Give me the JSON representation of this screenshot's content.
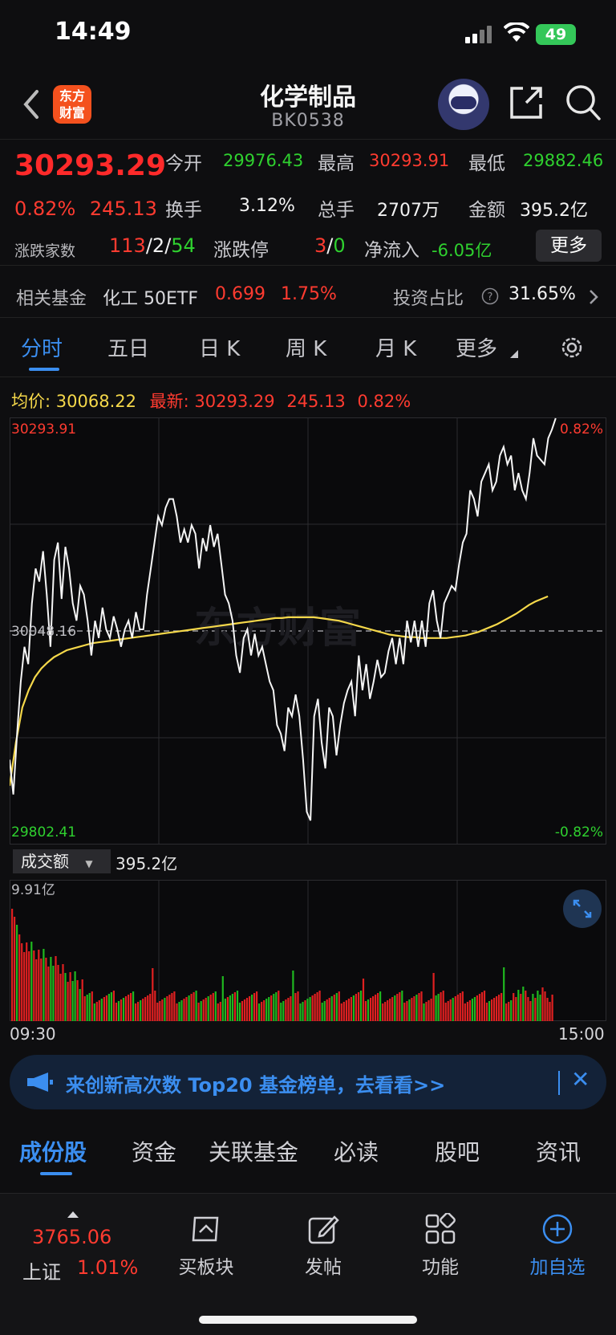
{
  "status_bar": {
    "time": "14:49",
    "battery": "49"
  },
  "header": {
    "title": "化学制品",
    "code": "BK0538",
    "logo_text": "东方财富"
  },
  "quote": {
    "last_price": "30293.29",
    "change_pct": "0.82%",
    "change_abs": "245.13",
    "open_label": "今开",
    "open_value": "29976.43",
    "high_label": "最高",
    "high_value": "30293.91",
    "low_label": "最低",
    "low_value": "29882.46",
    "turnover_rate_label": "换手",
    "turnover_rate_value": "3.12%",
    "volume_label": "总手",
    "volume_value": "2707万",
    "amount_label": "金额",
    "amount_value": "395.2亿",
    "breadth_label": "涨跌家数",
    "breadth_up": "113",
    "breadth_flat": "2",
    "breadth_down": "54",
    "breadth_sep": "/",
    "limit_label": "涨跌停",
    "limit_up": "3",
    "limit_down": "0",
    "netflow_label": "净流入",
    "netflow_value": "-6.05亿",
    "more_label": "更多"
  },
  "related_fund": {
    "label": "相关基金",
    "fund_name": "化工 50ETF",
    "fund_price": "0.699",
    "fund_pct": "1.75%",
    "ratio_label": "投资占比",
    "ratio_value": "31.65%"
  },
  "chart_tabs": [
    "分时",
    "五日",
    "日 K",
    "周 K",
    "月 K",
    "更多"
  ],
  "chart_header": {
    "avg_label": "均价:",
    "avg_value": "30068.22",
    "latest_label": "最新:",
    "latest_value": "30293.29",
    "latest_change": "245.13",
    "latest_pct": "0.82%"
  },
  "chart_data": {
    "type": "line",
    "y_top_label": "30293.91",
    "y_mid_label": "30048.16",
    "y_bottom_label": "29802.41",
    "pct_top_label": "0.82%",
    "pct_bottom_label": "-0.82%",
    "ylim": [
      29802.41,
      30293.91
    ],
    "prev_close": 30048.16,
    "x_start": "09:30",
    "x_end": "15:00",
    "series": [
      {
        "values": [
          29900,
          29860,
          29930,
          29990,
          30030,
          30010,
          30080,
          30120,
          30105,
          30140,
          30090,
          30030,
          30130,
          30150,
          30085,
          30145,
          30120,
          30080,
          30060,
          30100,
          30090,
          30060,
          30020,
          30060,
          30040,
          30075,
          30050,
          30040,
          30065,
          30050,
          30030,
          30050,
          30060,
          30040,
          30070,
          30050,
          30050,
          30090,
          30120,
          30150,
          30180,
          30170,
          30190,
          30200,
          30200,
          30180,
          30150,
          30165,
          30150,
          30170,
          30160,
          30120,
          30155,
          30140,
          30170,
          30145,
          30160,
          30125,
          30090,
          30080,
          30060,
          30020,
          30000,
          30040,
          30050,
          30020,
          30045,
          30020,
          30030,
          30010,
          29990,
          29980,
          29940,
          29930,
          29910,
          29960,
          29950,
          29975,
          29950,
          29900,
          29840,
          29830,
          29950,
          29970,
          29920,
          29890,
          29960,
          29950,
          29905,
          29940,
          29965,
          29980,
          29990,
          29950,
          30020,
          29980,
          30010,
          29970,
          29990,
          30015,
          29995,
          30000,
          30025,
          30040,
          30010,
          30040,
          30010,
          30060,
          30035,
          30060,
          30030,
          30060,
          30030,
          30080,
          30095,
          30060,
          30040,
          30080,
          30090,
          30100,
          30095,
          30125,
          30150,
          30160,
          30210,
          30200,
          30180,
          30220,
          30230,
          30240,
          30210,
          30220,
          30250,
          30260,
          30240,
          30250,
          30210,
          30230,
          30210,
          30200,
          30230,
          30270,
          30250,
          30245,
          30240,
          30270,
          30280,
          30293
        ]
      },
      {
        "name": "均价",
        "values": [
          29870,
          29920,
          29960,
          29980,
          29995,
          30005,
          30012,
          30018,
          30022,
          30026,
          30028,
          30030,
          30032,
          30034,
          30035,
          30036,
          30037,
          30038,
          30039,
          30040,
          30041,
          30042,
          30043,
          30044,
          30045,
          30046,
          30047,
          30048,
          30049,
          30050,
          30051,
          30052,
          30053,
          30054,
          30055,
          30056,
          30057,
          30058,
          30059,
          30060,
          30061,
          30062,
          30063,
          30063,
          30064,
          30064,
          30064,
          30064,
          30064,
          30063,
          30062,
          30061,
          30060,
          30058,
          30056,
          30054,
          30052,
          30050,
          30048,
          30046,
          30044,
          30043,
          30042,
          30041,
          30041,
          30040,
          30040,
          30040,
          30040,
          30040,
          30041,
          30042,
          30043,
          30045,
          30047,
          30050,
          30053,
          30056,
          30060,
          30064,
          30068,
          30073,
          30078,
          30082,
          30085,
          30088
        ]
      }
    ]
  },
  "volume": {
    "selector_label": "成交额",
    "total": "395.2亿",
    "max_label": "9.91亿"
  },
  "banner": {
    "text": "来创新高次数 Top20 基金榜单，去看看>>"
  },
  "lower_tabs": [
    "成份股",
    "资金",
    "关联基金",
    "必读",
    "股吧",
    "资讯"
  ],
  "bottom_bar": {
    "index_price": "3765.06",
    "index_name": "上证",
    "index_pct": "1.01%",
    "items": [
      "买板块",
      "发帖",
      "功能",
      "加自选"
    ]
  }
}
